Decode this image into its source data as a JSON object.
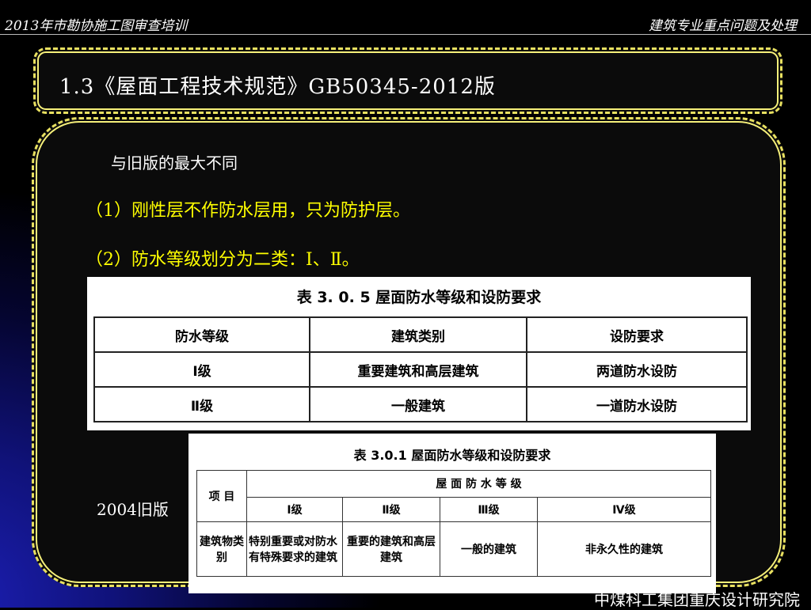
{
  "header": {
    "left_title": "2013年市勘协施工图审查培训",
    "right_title": "建筑专业重点问题及处理"
  },
  "slide": {
    "title": "1.3《屋面工程技术规范》GB50345-2012版",
    "subtitle": "与旧版的最大不同",
    "point1": "（1）刚性层不作防水层用，只为防护层。",
    "point2": "（2）防水等级划分为二类：Ⅰ、Ⅱ。",
    "old_label": "2004旧版"
  },
  "table_new": {
    "caption": "表 3. 0. 5   屋面防水等级和设防要求",
    "headers": [
      "防水等级",
      "建筑类别",
      "设防要求"
    ],
    "rows": [
      [
        "Ⅰ级",
        "重要建筑和高层建筑",
        "两道防水设防"
      ],
      [
        "Ⅱ级",
        "一般建筑",
        "一道防水设防"
      ]
    ]
  },
  "table_old": {
    "caption": "表 3.0.1   屋面防水等级和设防要求",
    "item_label": "项 目",
    "group_header": "屋 面 防 水 等 级",
    "levels": [
      "Ⅰ级",
      "Ⅱ级",
      "Ⅲ级",
      "Ⅳ级"
    ],
    "row_label": "建筑物类别",
    "row_values": [
      "特别重要或对防水有特殊要求的建筑",
      "重要的建筑和高层建筑",
      "一般的建筑",
      "非永久性的建筑"
    ]
  },
  "footer": {
    "org": "中煤科工集团重庆设计研究院"
  }
}
